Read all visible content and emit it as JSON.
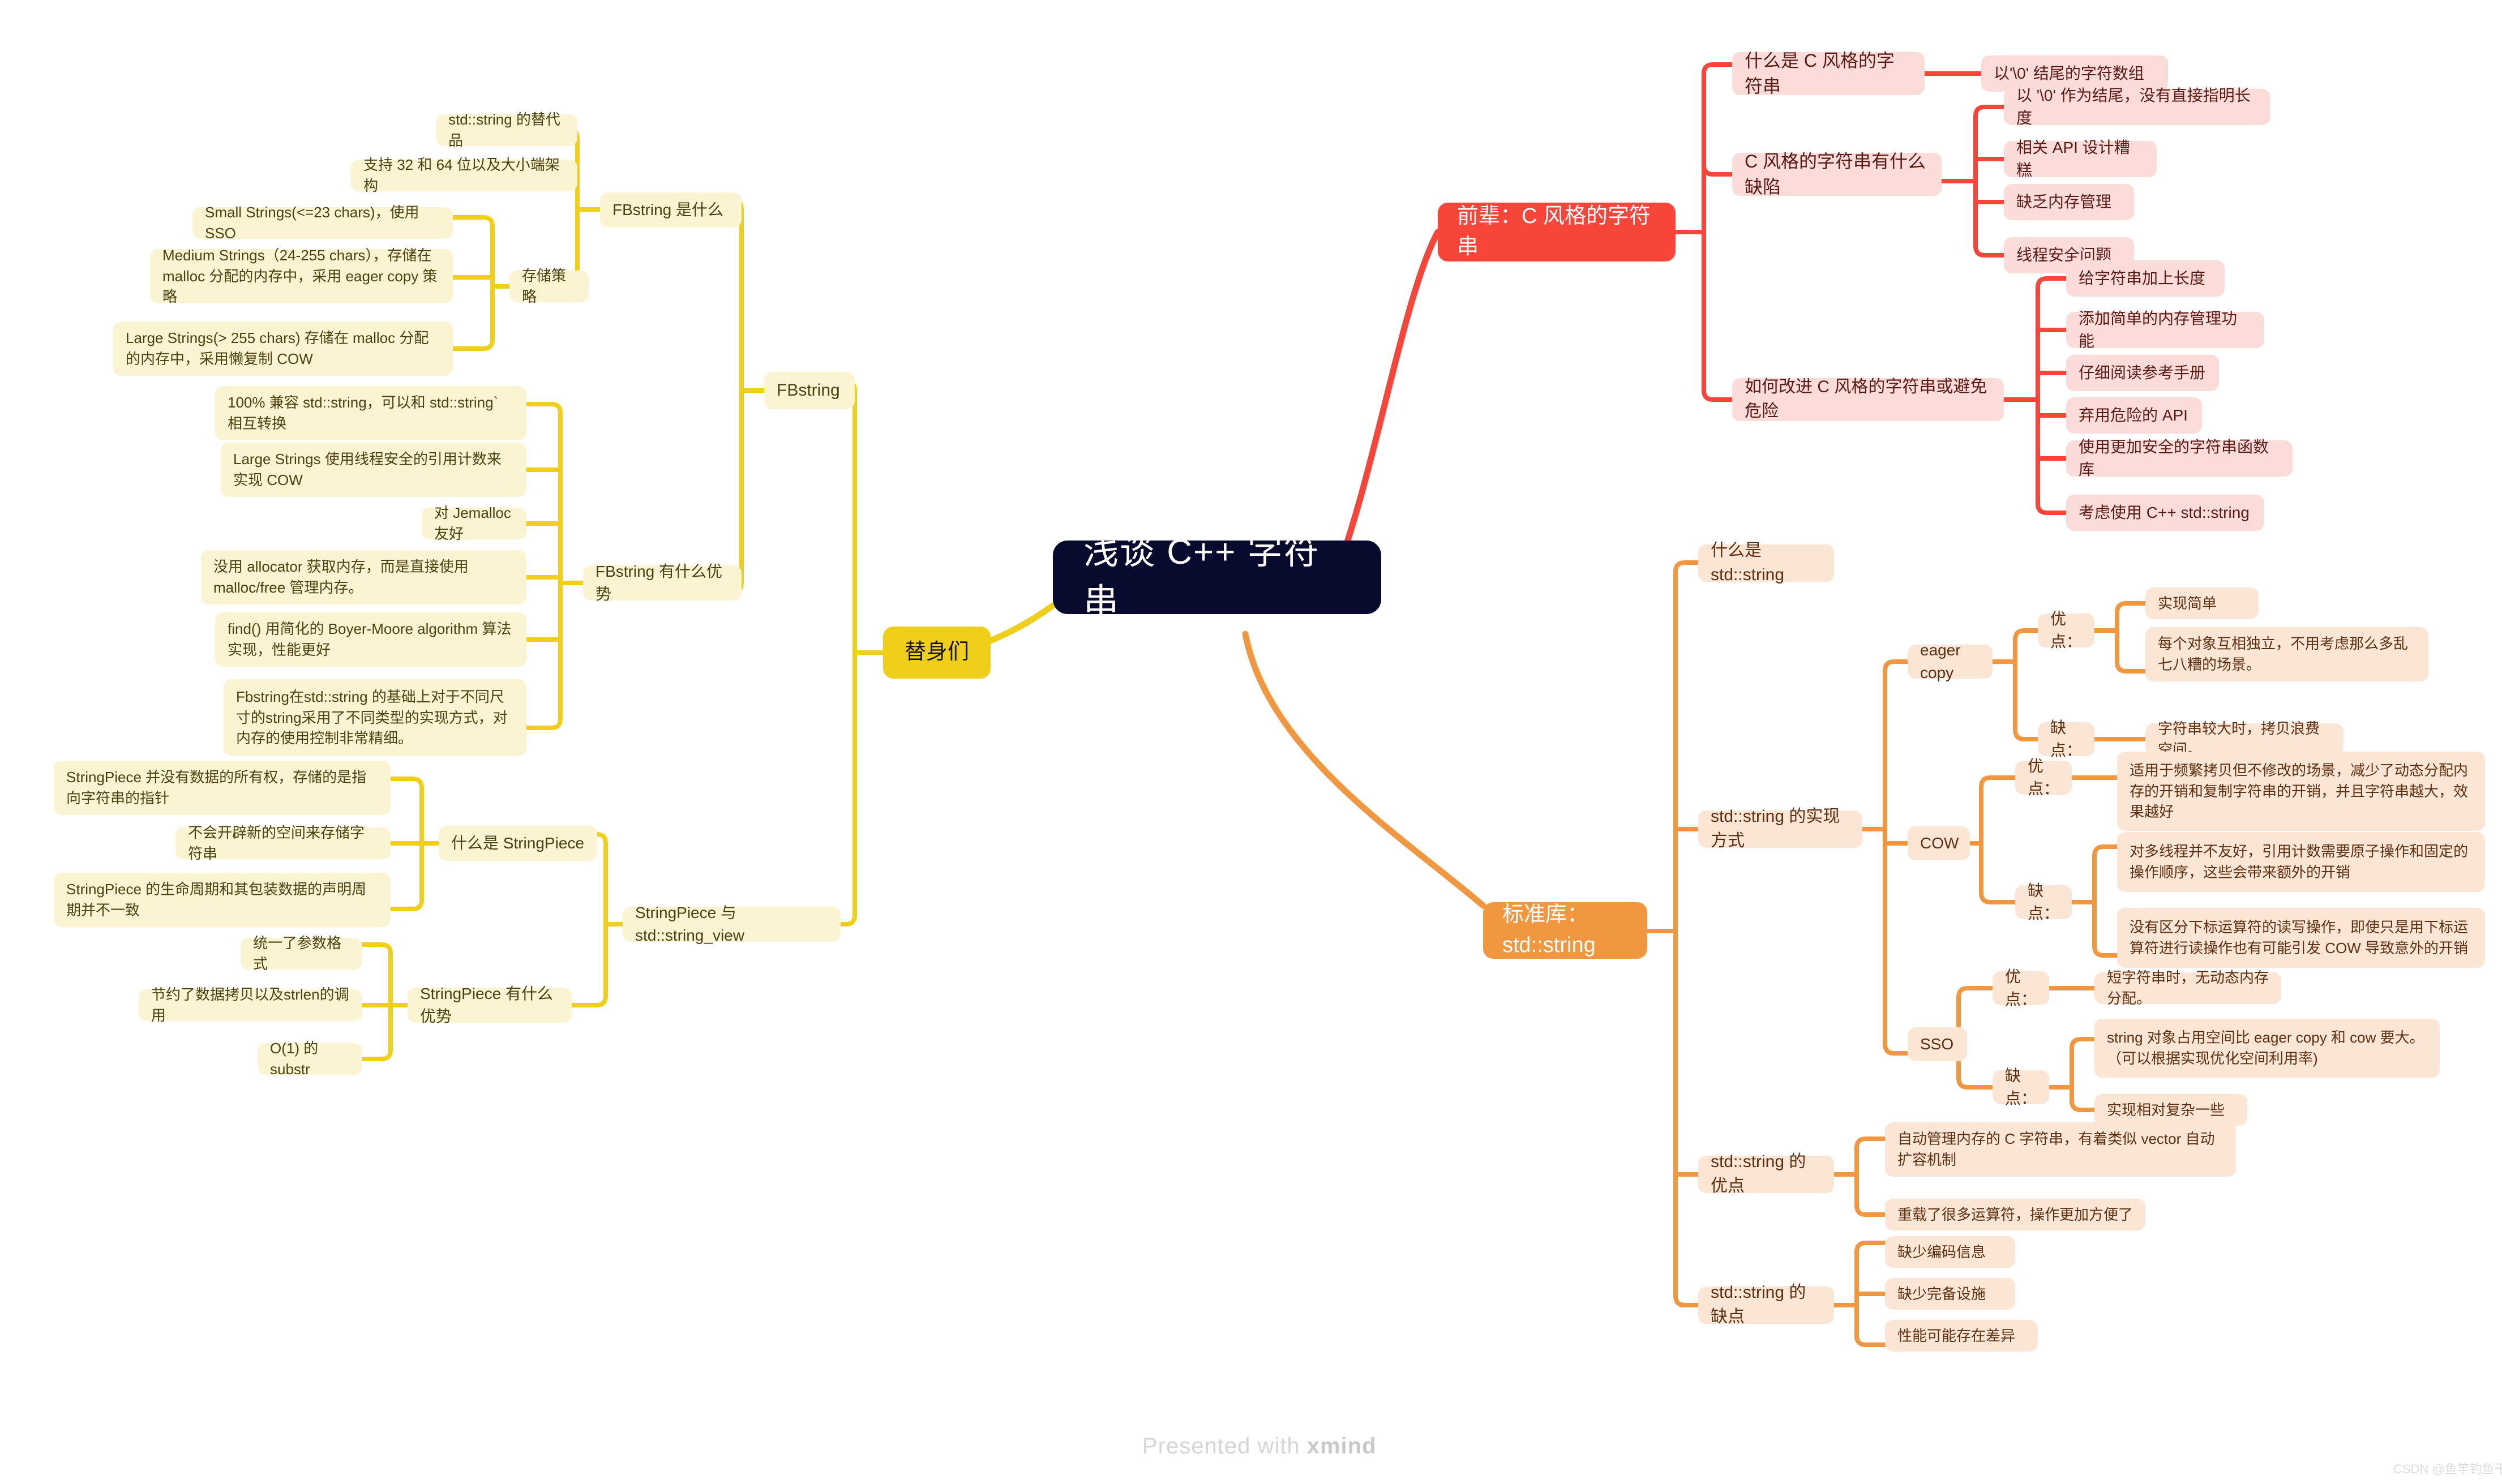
{
  "root": {
    "label": "浅谈 C++ 字符串"
  },
  "branches": {
    "c_style": {
      "label": "前辈：C 风格的字符串",
      "color": "#f8453a",
      "children": [
        {
          "label": "什么是 C 风格的字符串",
          "children": [
            {
              "label": "以'\\0' 结尾的字符数组"
            }
          ]
        },
        {
          "label": "C 风格的字符串有什么缺陷",
          "children": [
            {
              "label": "以 '\\0' 作为结尾，没有直接指明长度"
            },
            {
              "label": "相关 API 设计糟糕"
            },
            {
              "label": "缺乏内存管理"
            },
            {
              "label": "线程安全问题"
            }
          ]
        },
        {
          "label": "如何改进 C 风格的字符串或避免危险",
          "children": [
            {
              "label": "给字符串加上长度"
            },
            {
              "label": "添加简单的内存管理功能"
            },
            {
              "label": "仔细阅读参考手册"
            },
            {
              "label": "弃用危险的 API"
            },
            {
              "label": "使用更加安全的字符串函数库"
            },
            {
              "label": "考虑使用 C++ std::string"
            }
          ]
        }
      ]
    },
    "std_string": {
      "label": "标准库：std::string",
      "color": "#f1973f",
      "children": [
        {
          "label": "什么是 std::string",
          "children": []
        },
        {
          "label": "std::string 的实现方式",
          "children": [
            {
              "label": "eager copy",
              "children": [
                {
                  "label": "优点：",
                  "children": [
                    {
                      "label": "实现简单"
                    },
                    {
                      "label": "每个对象互相独立，不用考虑那么多乱七八糟的场景。"
                    }
                  ]
                },
                {
                  "label": "缺点：",
                  "children": [
                    {
                      "label": "字符串较大时，拷贝浪费空间。"
                    }
                  ]
                }
              ]
            },
            {
              "label": "COW",
              "children": [
                {
                  "label": "优点：",
                  "children": [
                    {
                      "label": "适用于频繁拷贝但不修改的场景，减少了动态分配内存的开销和复制字符串的开销，并且字符串越大，效果越好"
                    }
                  ]
                },
                {
                  "label": "缺点：",
                  "children": [
                    {
                      "label": "对多线程并不友好，引用计数需要原子操作和固定的操作顺序，这些会带来额外的开销"
                    },
                    {
                      "label": "没有区分下标运算符的读写操作，即使只是用下标运算符进行读操作也有可能引发 COW 导致意外的开销"
                    }
                  ]
                }
              ]
            },
            {
              "label": "SSO",
              "children": [
                {
                  "label": "优点：",
                  "children": [
                    {
                      "label": "短字符串时，无动态内存分配。"
                    }
                  ]
                },
                {
                  "label": "缺点：",
                  "children": [
                    {
                      "label": "string 对象占用空间比 eager copy 和 cow 要大。（可以根据实现优化空间利用率)"
                    },
                    {
                      "label": "实现相对复杂一些"
                    }
                  ]
                }
              ]
            }
          ]
        },
        {
          "label": "std::string 的优点",
          "children": [
            {
              "label": "自动管理内存的 C 字符串，有着类似 vector 自动扩容机制"
            },
            {
              "label": "重载了很多运算符，操作更加方便了"
            }
          ]
        },
        {
          "label": "std::string 的缺点",
          "children": [
            {
              "label": "缺少编码信息"
            },
            {
              "label": "缺少完备设施"
            },
            {
              "label": "性能可能存在差异"
            }
          ]
        }
      ]
    },
    "substitutes": {
      "label": "替身们",
      "color": "#f0cf1a",
      "children": [
        {
          "label": "FBstring",
          "children": [
            {
              "label": "FBstring 是什么",
              "children": [
                {
                  "label": "std::string 的替代品"
                },
                {
                  "label": "支持 32 和 64 位以及大小端架构"
                },
                {
                  "label": "存储策略",
                  "children": [
                    {
                      "label": "Small Strings(<=23 chars)，使用 SSO"
                    },
                    {
                      "label": "Medium Strings（24-255 chars），存储在 malloc 分配的内存中，采用 eager copy 策略"
                    },
                    {
                      "label": "Large Strings(> 255 chars) 存储在 malloc 分配的内存中，采用懒复制 COW"
                    }
                  ]
                }
              ]
            },
            {
              "label": "FBstring 有什么优势",
              "children": [
                {
                  "label": "100% 兼容 std::string，可以和 std::string` 相互转换"
                },
                {
                  "label": "Large Strings 使用线程安全的引用计数来实现 COW"
                },
                {
                  "label": "对 Jemalloc 友好"
                },
                {
                  "label": "没用 allocator 获取内存，而是直接使用 malloc/free 管理内存。"
                },
                {
                  "label": "find() 用简化的 Boyer-Moore algorithm 算法实现，性能更好"
                },
                {
                  "label": "Fbstring在std::string 的基础上对于不同尺寸的string采用了不同类型的实现方式，对内存的使用控制非常精细。"
                }
              ]
            }
          ]
        },
        {
          "label": "StringPiece 与 std::string_view",
          "children": [
            {
              "label": "什么是 StringPiece",
              "children": [
                {
                  "label": "StringPiece 并没有数据的所有权，存储的是指向字符串的指针"
                },
                {
                  "label": "不会开辟新的空间来存储字符串"
                },
                {
                  "label": "StringPiece 的生命周期和其包装数据的声明周期并不一致"
                }
              ]
            },
            {
              "label": "StringPiece 有什么优势",
              "children": [
                {
                  "label": "统一了参数格式"
                },
                {
                  "label": "节约了数据拷贝以及strlen的调用"
                },
                {
                  "label": "O(1) 的 substr"
                }
              ]
            }
          ]
        }
      ]
    }
  },
  "footer": {
    "presented_prefix": "Presented with ",
    "presented_brand": "xmind"
  },
  "csdn_watermark": "CSDN @鱼竿钓鱼干"
}
